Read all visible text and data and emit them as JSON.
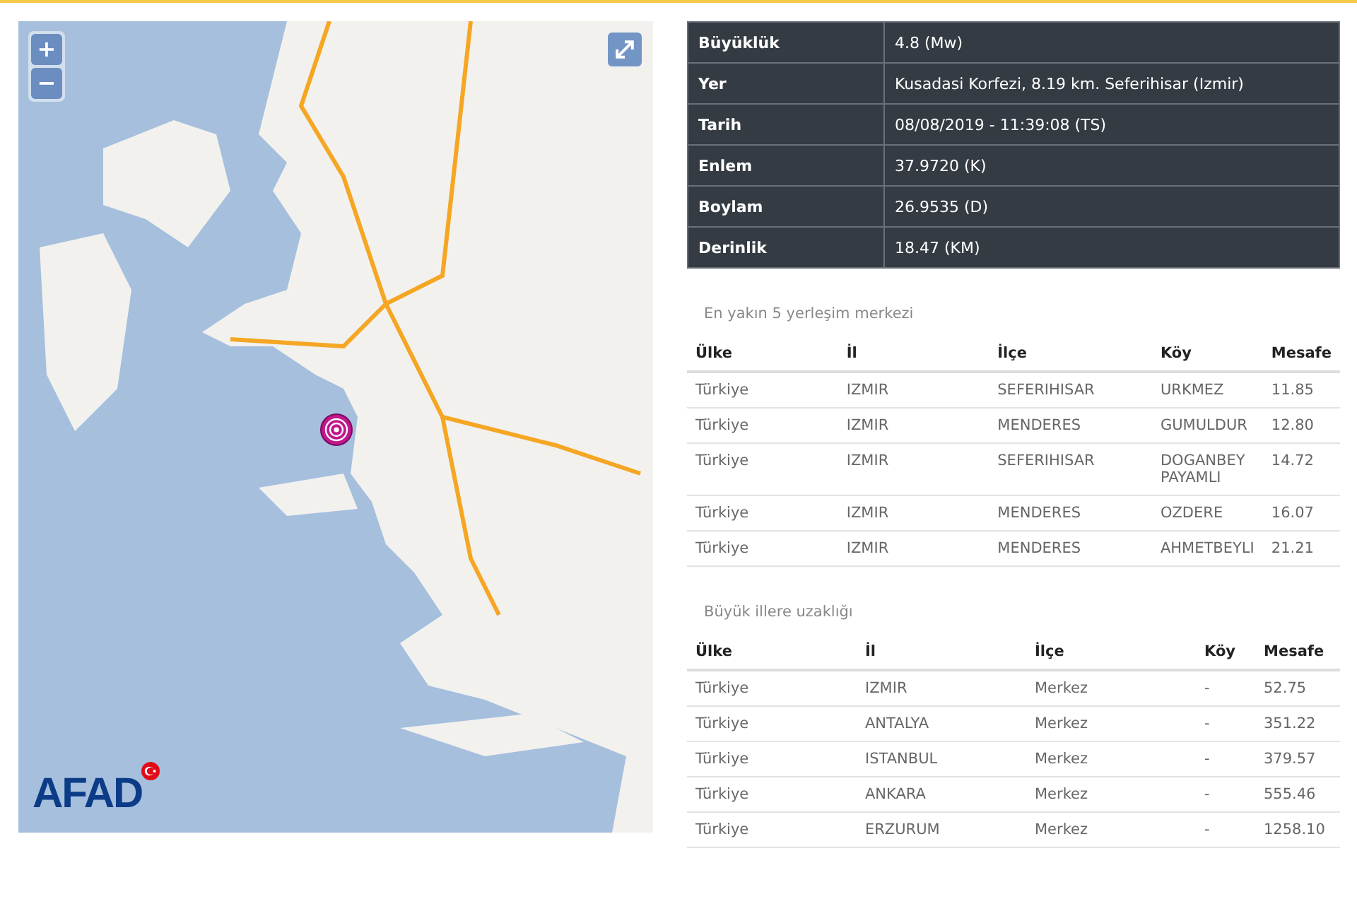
{
  "map": {
    "zoom_in": "+",
    "zoom_out": "−",
    "logo": "AFAD"
  },
  "details": [
    {
      "label": "Büyüklük",
      "value": "4.8 (Mw)"
    },
    {
      "label": "Yer",
      "value": "Kusadasi Korfezi, 8.19 km. Seferihisar (Izmir)"
    },
    {
      "label": "Tarih",
      "value": "08/08/2019 - 11:39:08 (TS)"
    },
    {
      "label": "Enlem",
      "value": "37.9720 (K)"
    },
    {
      "label": "Boylam",
      "value": "26.9535 (D)"
    },
    {
      "label": "Derinlik",
      "value": "18.47 (KM)"
    }
  ],
  "tables": [
    {
      "title": "En yakın 5 yerleşim merkezi",
      "columns": [
        "Ülke",
        "İl",
        "İlçe",
        "Köy",
        "Mesafe"
      ],
      "rows": [
        [
          "Türkiye",
          "IZMIR",
          "SEFERIHISAR",
          "URKMEZ",
          "11.85"
        ],
        [
          "Türkiye",
          "IZMIR",
          "MENDERES",
          "GUMULDUR",
          "12.80"
        ],
        [
          "Türkiye",
          "IZMIR",
          "SEFERIHISAR",
          "DOGANBEY PAYAMLI",
          "14.72"
        ],
        [
          "Türkiye",
          "IZMIR",
          "MENDERES",
          "OZDERE",
          "16.07"
        ],
        [
          "Türkiye",
          "IZMIR",
          "MENDERES",
          "AHMETBEYLI",
          "21.21"
        ]
      ]
    },
    {
      "title": "Büyük illere uzaklığı",
      "columns": [
        "Ülke",
        "İl",
        "İlçe",
        "Köy",
        "Mesafe"
      ],
      "rows": [
        [
          "Türkiye",
          "IZMIR",
          "Merkez",
          "-",
          "52.75"
        ],
        [
          "Türkiye",
          "ANTALYA",
          "Merkez",
          "-",
          "351.22"
        ],
        [
          "Türkiye",
          "ISTANBUL",
          "Merkez",
          "-",
          "379.57"
        ],
        [
          "Türkiye",
          "ANKARA",
          "Merkez",
          "-",
          "555.46"
        ],
        [
          "Türkiye",
          "ERZURUM",
          "Merkez",
          "-",
          "1258.10"
        ]
      ]
    }
  ]
}
